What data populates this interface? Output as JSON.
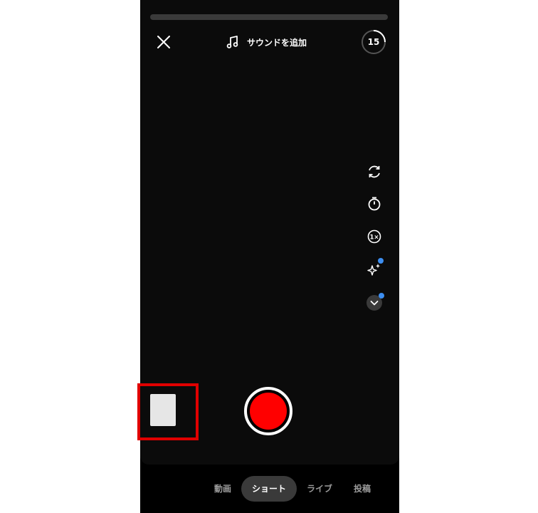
{
  "top_bar": {
    "sound_label": "サウンドを追加",
    "timer_value": "15",
    "timer_progress": 0.25
  },
  "side_tools": [
    {
      "icon": "flip-camera-icon",
      "dot": false
    },
    {
      "icon": "timer-icon",
      "dot": false
    },
    {
      "icon": "speed-1x-icon",
      "dot": false
    },
    {
      "icon": "effects-sparkle-icon",
      "dot": true
    },
    {
      "icon": "chevron-down-icon",
      "dot": true
    }
  ],
  "modes": {
    "video": "動画",
    "short": "ショート",
    "live": "ライブ",
    "post": "投稿",
    "active": "ショート"
  },
  "colors": {
    "record": "#ff0000",
    "highlight": "#e00000",
    "badge_dot": "#3d8ef0",
    "active_mode_bg": "#3a3a3a"
  }
}
